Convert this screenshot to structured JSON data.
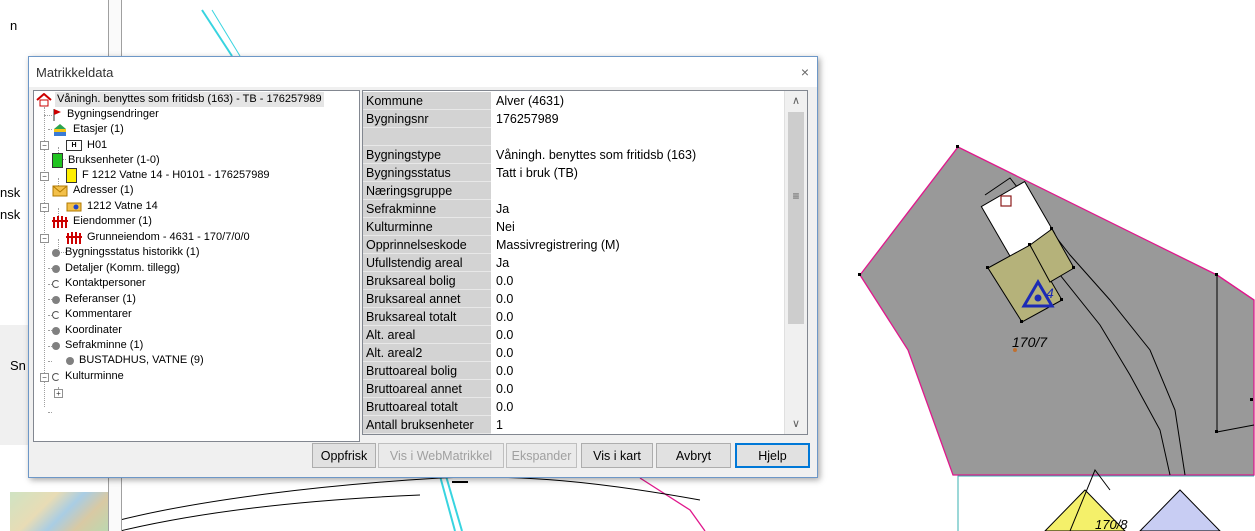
{
  "background": {
    "left_texts": [
      "n",
      "nsk",
      "nsk",
      "Sn"
    ],
    "map_labels": {
      "parcel": "170/7",
      "parcel_partial": "170/8",
      "building_mark": "4"
    }
  },
  "dialog": {
    "title": "Matrikkeldata",
    "close_glyph": "×",
    "tree": {
      "root": "Våningh. benyttes som fritidsb (163) - TB - 176257989",
      "bygningsendringer": "Bygningsendringer",
      "etasjer": "Etasjer (1)",
      "etasje_h01": "H01",
      "etasje_badge": "H",
      "bruksenheter": "Bruksenheter (1-0)",
      "bruksenhet_f": "F 1212 Vatne 14 - H0101 - 176257989",
      "adresser": "Adresser (1)",
      "adresse_1": "1212 Vatne 14",
      "eiendommer": "Eiendommer (1)",
      "grunneiendom": "Grunneiendom - 4631 - 170/7/0/0",
      "bygningsstatus_historikk": "Bygningsstatus historikk (1)",
      "detaljer": "Detaljer (Komm. tillegg)",
      "kontaktpersoner": "Kontaktpersoner",
      "referanser": "Referanser (1)",
      "kommentarer": "Kommentarer",
      "koordinater": "Koordinater",
      "sefrakminne": "Sefrakminne (1)",
      "bustadhus": "BUSTADHUS, VATNE (9)",
      "kulturminne": "Kulturminne"
    },
    "grid": {
      "rows": [
        {
          "label": "Kommune",
          "value": "Alver (4631)"
        },
        {
          "label": "Bygningsnr",
          "value": "176257989"
        },
        {
          "label": "",
          "value": ""
        },
        {
          "label": "Bygningstype",
          "value": "Våningh. benyttes som fritidsb (163)"
        },
        {
          "label": "Bygningsstatus",
          "value": "Tatt i bruk (TB)"
        },
        {
          "label": "Næringsgruppe",
          "value": ""
        },
        {
          "label": "Sefrakminne",
          "value": "Ja"
        },
        {
          "label": "Kulturminne",
          "value": "Nei"
        },
        {
          "label": "Opprinnelseskode",
          "value": "Massivregistrering (M)"
        },
        {
          "label": "Ufullstendig areal",
          "value": "Ja"
        },
        {
          "label": "Bruksareal bolig",
          "value": "0.0"
        },
        {
          "label": "Bruksareal annet",
          "value": "0.0"
        },
        {
          "label": "Bruksareal totalt",
          "value": "0.0"
        },
        {
          "label": "Alt. areal",
          "value": "0.0"
        },
        {
          "label": "Alt. areal2",
          "value": "0.0"
        },
        {
          "label": "Bruttoareal bolig",
          "value": "0.0"
        },
        {
          "label": "Bruttoareal annet",
          "value": "0.0"
        },
        {
          "label": "Bruttoareal totalt",
          "value": "0.0"
        },
        {
          "label": "Antall bruksenheter",
          "value": "1"
        }
      ],
      "scroll_up": "∧",
      "scroll_down": "∨",
      "scroll_grip": "≡"
    },
    "buttons": {
      "oppfrisk": "Oppfrisk",
      "vis_webmatrikkel": "Vis i WebMatrikkel",
      "ekspander": "Ekspander",
      "vis_i_kart": "Vis i kart",
      "avbryt": "Avbryt",
      "hjelp": "Hjelp"
    }
  },
  "colors": {
    "parcel_fill": "#999999",
    "parcel_border": "#e0188c",
    "building_fill": "#b5b27a",
    "symbol_blue": "#1c2bb5"
  }
}
